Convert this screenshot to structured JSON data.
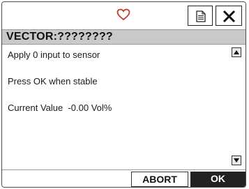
{
  "titlebar": {
    "status_icon": "heart-outline-icon",
    "status_icon_color": "#c0392b",
    "document_button_icon": "document-icon",
    "close_button_icon": "close-x-icon"
  },
  "header": {
    "title": "VECTOR:????????"
  },
  "content": {
    "lines": [
      "Apply 0 input to sensor",
      "Press OK when stable",
      "Current Value  -0.00 Vol%"
    ]
  },
  "scrollbar": {
    "up_icon": "arrow-up-icon",
    "down_icon": "arrow-down-icon"
  },
  "footer": {
    "abort_label": "ABORT",
    "ok_label": "OK"
  },
  "colors": {
    "header_bg": "#c9c9c9",
    "ok_bg": "#222222",
    "ok_text": "#ffffff"
  }
}
